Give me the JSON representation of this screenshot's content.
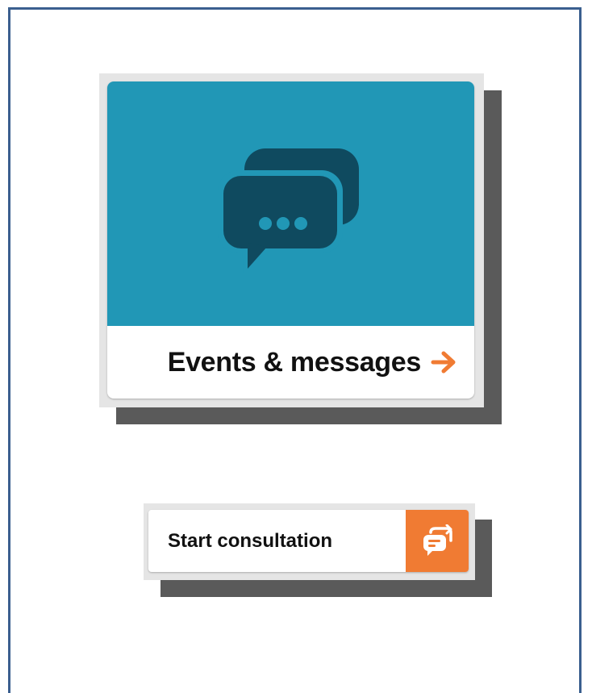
{
  "colors": {
    "frame_border": "#3b5f8f",
    "card_top": "#2197b6",
    "card_icon": "#0f4a5f",
    "card_icon_dots": "#2197b6",
    "accent_orange": "#f07b33",
    "shadow": "#5a5a5a",
    "wrap_bg": "#e5e5e5"
  },
  "events_card": {
    "label": "Events & messages",
    "icon": "chat-bubbles-icon",
    "arrow_icon": "arrow-right-icon"
  },
  "consultation_button": {
    "label": "Start consultation",
    "icon": "chat-refresh-icon"
  }
}
